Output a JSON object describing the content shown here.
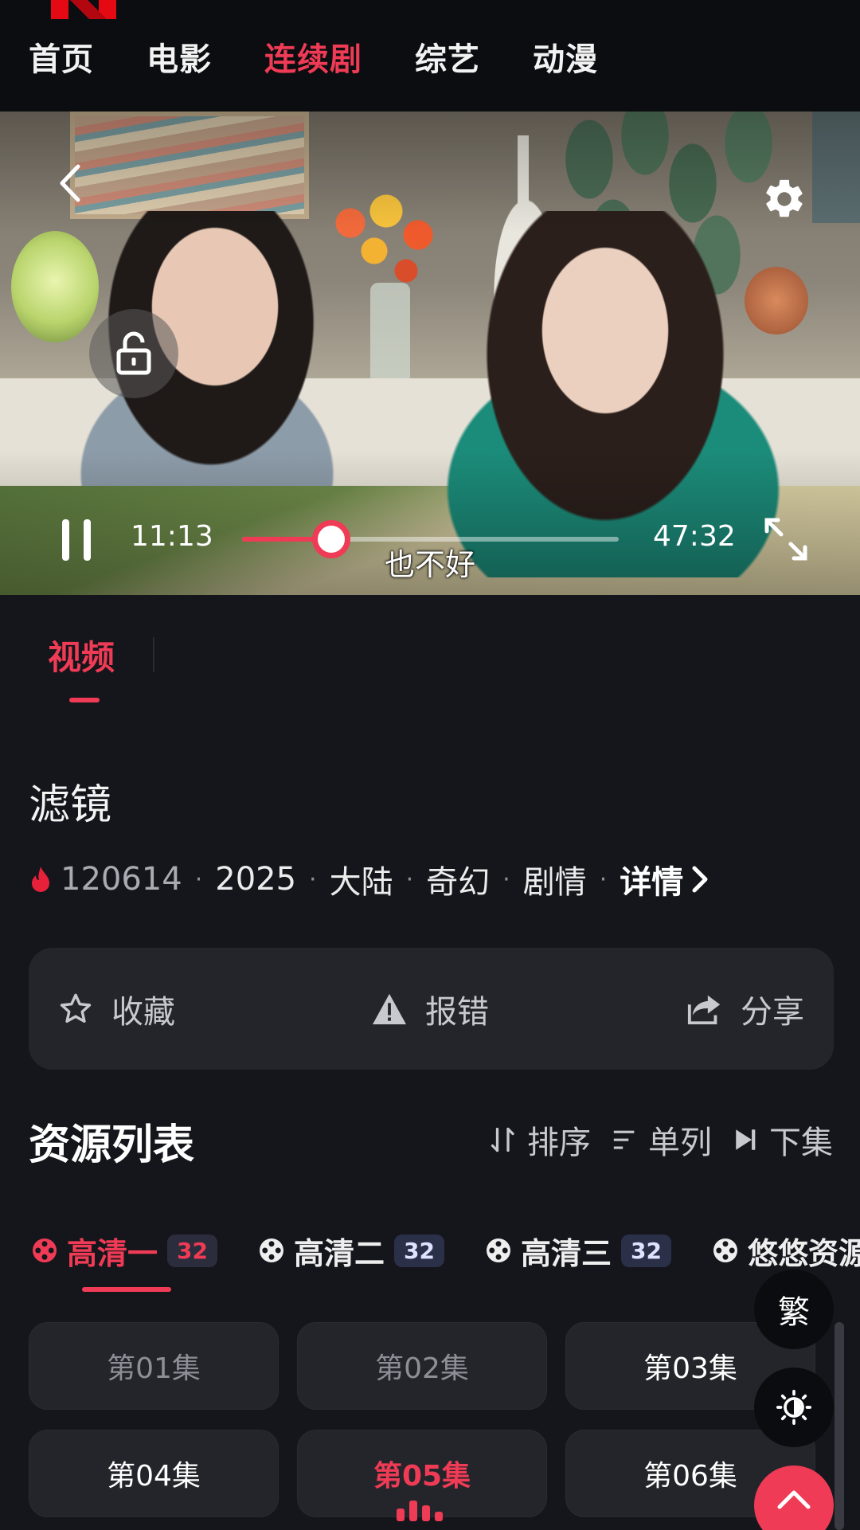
{
  "app": {
    "logo": "N",
    "accent_color": "#ef3b55"
  },
  "nav": {
    "items": [
      {
        "label": "首页",
        "active": false
      },
      {
        "label": "电影",
        "active": false
      },
      {
        "label": "连续剧",
        "active": true
      },
      {
        "label": "综艺",
        "active": false
      },
      {
        "label": "动漫",
        "active": false
      }
    ]
  },
  "player": {
    "current_time": "11:13",
    "total_time": "47:32",
    "progress_fraction": 0.236,
    "subtitle": "也不好",
    "icons": [
      "back-icon",
      "settings-gear-icon",
      "lock-icon",
      "pause-icon",
      "fullscreen-icon"
    ]
  },
  "tabs": {
    "video": "视频"
  },
  "show": {
    "title": "滤镜",
    "views": "120614",
    "year": "2025",
    "region": "大陆",
    "genre1": "奇幻",
    "genre2": "剧情",
    "detail_label": "详情"
  },
  "actions": {
    "favorite": "收藏",
    "report": "报错",
    "share": "分享"
  },
  "resources": {
    "title": "资源列表",
    "sort": "排序",
    "single_column": "单列",
    "next_episode": "下集",
    "sources": [
      {
        "label": "高清一",
        "count": "32",
        "active": true
      },
      {
        "label": "高清二",
        "count": "32",
        "active": false
      },
      {
        "label": "高清三",
        "count": "32",
        "active": false
      },
      {
        "label": "悠悠资源",
        "count": "",
        "active": false
      }
    ],
    "episodes": [
      {
        "label": "第01集",
        "state": "watched"
      },
      {
        "label": "第02集",
        "state": "watched"
      },
      {
        "label": "第03集",
        "state": "normal"
      },
      {
        "label": "第04集",
        "state": "normal"
      },
      {
        "label": "第05集",
        "state": "current"
      },
      {
        "label": "第06集",
        "state": "normal"
      }
    ]
  },
  "floating": {
    "traditional": "繁",
    "icons": [
      "brightness-icon",
      "scroll-top-icon"
    ]
  }
}
